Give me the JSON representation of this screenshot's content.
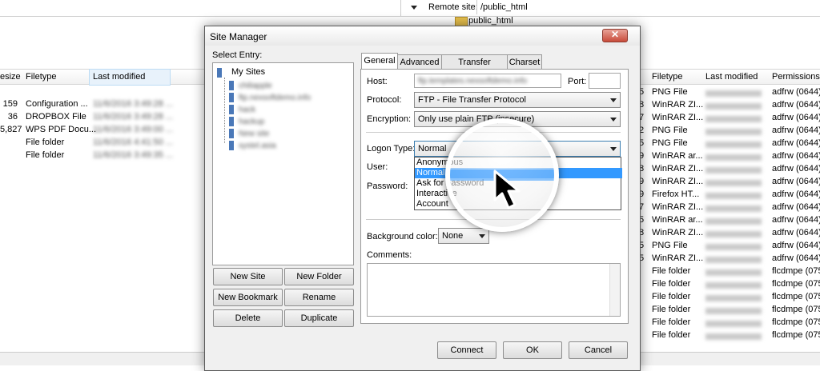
{
  "top": {
    "remote_site_label": "Remote site:",
    "remote_path": "/public_html",
    "tree_item": "public_html"
  },
  "left_pane": {
    "headers": [
      "esize",
      "Filetype",
      "Last modified"
    ],
    "rows": [
      {
        "size": "159",
        "type": "Configuration ...",
        "mod": "11/6/2016 3:49:28 ..."
      },
      {
        "size": "36",
        "type": "DROPBOX File",
        "mod": "11/6/2016 3:49:28 ..."
      },
      {
        "size": "5,827",
        "type": "WPS PDF Docu...",
        "mod": "11/6/2016 3:49:00 ..."
      },
      {
        "size": "",
        "type": "File folder",
        "mod": "11/6/2016 4:41:50 ..."
      },
      {
        "size": "",
        "type": "File folder",
        "mod": "11/6/2016 3:49:35 ..."
      }
    ]
  },
  "right_pane": {
    "headers": [
      "Filetype",
      "Last modified",
      "Permissions"
    ],
    "rows": [
      {
        "num": "5",
        "type": "PNG File",
        "mod": "",
        "perm": "adfrw (0644)"
      },
      {
        "num": "8",
        "type": "WinRAR ZI...",
        "mod": "",
        "perm": "adfrw (0644)"
      },
      {
        "num": "7",
        "type": "WinRAR ZI...",
        "mod": "",
        "perm": "adfrw (0644)"
      },
      {
        "num": "2",
        "type": "PNG File",
        "mod": "",
        "perm": "adfrw (0644)"
      },
      {
        "num": "5",
        "type": "PNG File",
        "mod": "",
        "perm": "adfrw (0644)"
      },
      {
        "num": "9",
        "type": "WinRAR ar...",
        "mod": "",
        "perm": "adfrw (0644)"
      },
      {
        "num": "8",
        "type": "WinRAR ZI...",
        "mod": "",
        "perm": "adfrw (0644)"
      },
      {
        "num": "9",
        "type": "WinRAR ZI...",
        "mod": "",
        "perm": "adfrw (0644)"
      },
      {
        "num": "9",
        "type": "Firefox HT...",
        "mod": "",
        "perm": "adfrw (0644)"
      },
      {
        "num": "7",
        "type": "WinRAR ZI...",
        "mod": "",
        "perm": "adfrw (0644)"
      },
      {
        "num": "5",
        "type": "WinRAR ar...",
        "mod": "",
        "perm": "adfrw (0644)"
      },
      {
        "num": "8",
        "type": "WinRAR ZI...",
        "mod": "",
        "perm": "adfrw (0644)"
      },
      {
        "num": "5",
        "type": "PNG File",
        "mod": "",
        "perm": "adfrw (0644)"
      },
      {
        "num": "5",
        "type": "WinRAR ZI...",
        "mod": "",
        "perm": "adfrw (0644)"
      },
      {
        "num": "",
        "type": "File folder",
        "mod": "",
        "perm": "flcdmpe (0755)"
      },
      {
        "num": "",
        "type": "File folder",
        "mod": "",
        "perm": "flcdmpe (0755)"
      },
      {
        "num": "",
        "type": "File folder",
        "mod": "",
        "perm": "flcdmpe (0755)"
      },
      {
        "num": "",
        "type": "File folder",
        "mod": "",
        "perm": "flcdmpe (0755)"
      },
      {
        "num": "",
        "type": "File folder",
        "mod": "",
        "perm": "flcdmpe (0755)"
      },
      {
        "num": "",
        "type": "File folder",
        "mod": "",
        "perm": "flcdmpe (0755)"
      }
    ]
  },
  "dialog": {
    "title": "Site Manager",
    "close_icon": "close-icon",
    "select_entry_label": "Select Entry:",
    "tree_root": "My Sites",
    "tree_items": [
      "chiliapple",
      "ftp.nexsoftdemo.info",
      "hack",
      "hackup",
      "New site",
      "systel.asia"
    ],
    "tabs": [
      "General",
      "Advanced",
      "Transfer Settings",
      "Charset"
    ],
    "host_label": "Host:",
    "host_value": "ftp.templates.nexsoftdemo.info",
    "port_label": "Port:",
    "port_value": "",
    "protocol_label": "Protocol:",
    "protocol_value": "FTP - File Transfer Protocol",
    "encryption_label": "Encryption:",
    "encryption_value": "Only use plain FTP (insecure)",
    "logon_label": "Logon Type:",
    "logon_value": "Normal",
    "logon_options": [
      "Anonymous",
      "Normal",
      "Ask for password",
      "Interactive",
      "Account"
    ],
    "user_label": "User:",
    "password_label": "Password:",
    "bg_color_label": "Background color:",
    "bg_color_value": "None",
    "comments_label": "Comments:",
    "buttons": {
      "new_site": "New Site",
      "new_folder": "New Folder",
      "new_bookmark": "New Bookmark",
      "rename": "Rename",
      "delete": "Delete",
      "duplicate": "Duplicate",
      "connect": "Connect",
      "ok": "OK",
      "cancel": "Cancel"
    }
  },
  "colors": {
    "selection": "#3399ff",
    "accent": "#4a78b8"
  }
}
